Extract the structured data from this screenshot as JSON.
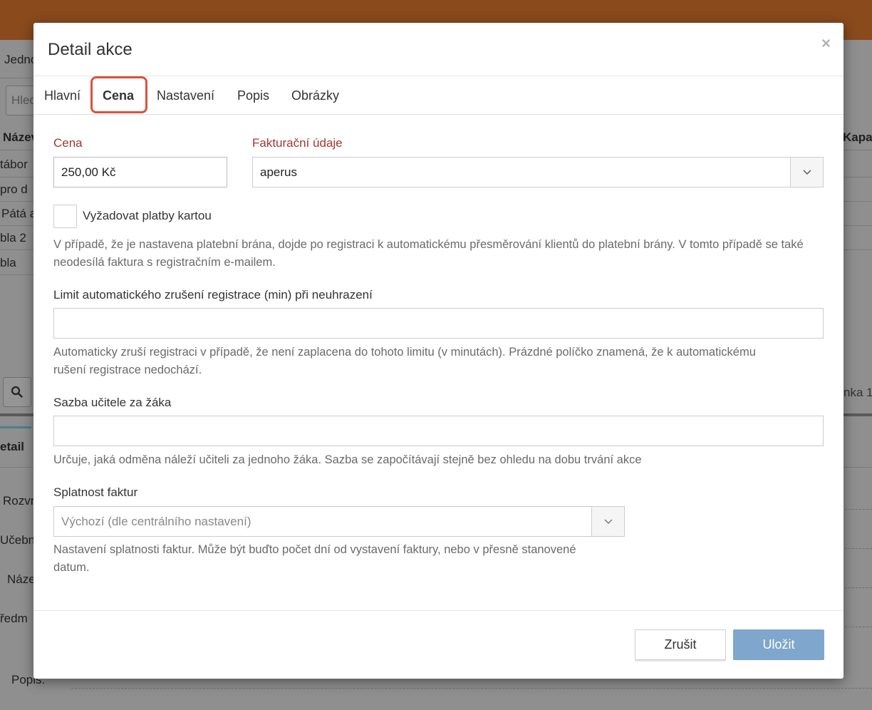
{
  "background": {
    "partial_texts": [
      "Jedno",
      "Hled",
      "Název",
      "tábor",
      "pro d",
      "Pátá a",
      "bla 2",
      "bla",
      "Kapac",
      "nka 1",
      "etail",
      "Rozvr",
      "Učebn",
      "Náze",
      "ředm",
      "Popis:"
    ]
  },
  "modal": {
    "title": "Detail akce",
    "close_glyph": "×",
    "tabs": [
      {
        "label": "Hlavní"
      },
      {
        "label": "Cena"
      },
      {
        "label": "Nastavení"
      },
      {
        "label": "Popis"
      },
      {
        "label": "Obrázky"
      }
    ],
    "price": {
      "label": "Cena",
      "value": "250,00 Kč"
    },
    "billing": {
      "label": "Fakturační údaje",
      "value": "aperus"
    },
    "card_payment": {
      "label": "Vyžadovat platby kartou",
      "checked": false,
      "help": "V případě, že je nastavena platební brána, dojde po registraci k automatickému přesměrování klientů do platební brány. V tomto případě se také neodesílá faktura s registračním e-mailem."
    },
    "auto_cancel": {
      "label": "Limit automatického zrušení registrace (min) při neuhrazení",
      "value": "",
      "help": "Automaticky zruší registraci v případě, že není zaplacena do tohoto limitu (v minutách). Prázdné políčko znamená, že k automatickému rušení registrace nedochází."
    },
    "teacher_rate": {
      "label": "Sazba učitele za žáka",
      "value": "",
      "help": "Určuje, jaká odměna náleží učiteli za jednoho žáka. Sazba se započítávají stejně bez ohledu na dobu trvání akce"
    },
    "due_date": {
      "label": "Splatnost faktur",
      "value": "Výchozí (dle centrálního nastavení)",
      "help": "Nastavení splatnosti faktur. Může být buďto počet dní od vystavení faktury, nebo v přesně stanovené datum."
    },
    "buttons": {
      "cancel": "Zrušit",
      "save": "Uložit"
    }
  },
  "colors": {
    "topbar": "#8a4a1c",
    "required_label": "#a8352e",
    "tab_highlight": "#d9533d",
    "save_button": "#7fa6cc"
  }
}
